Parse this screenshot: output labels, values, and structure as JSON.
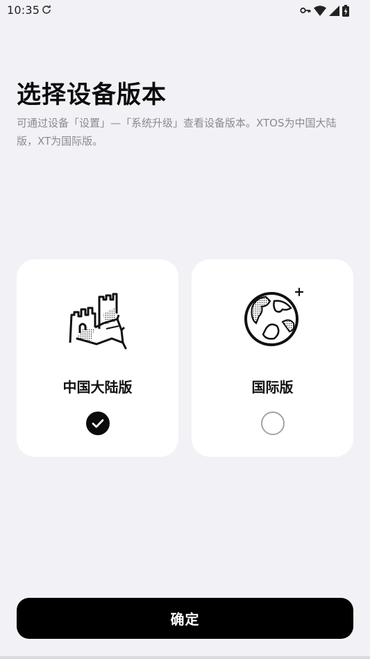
{
  "status_bar": {
    "time": "10:35",
    "icons": [
      "sync-icon",
      "vpn-key-icon",
      "wifi-icon",
      "cellular-signal-icon",
      "battery-charging-icon"
    ]
  },
  "header": {
    "title": "选择设备版本",
    "subtitle": "可通过设备「设置」—「系统升级」查看设备版本。XTOS为中国大陆版，XT为国际版。"
  },
  "options": [
    {
      "label": "中国大陆版",
      "icon": "great-wall-icon",
      "selected": true
    },
    {
      "label": "国际版",
      "icon": "globe-icon",
      "selected": false
    }
  ],
  "footer": {
    "confirm_label": "确定"
  },
  "colors": {
    "background": "#f2f1f6",
    "card": "#ffffff",
    "primary": "#000000",
    "subtitle": "#8a8a8f",
    "radio_unchecked": "#a3a3a6"
  }
}
